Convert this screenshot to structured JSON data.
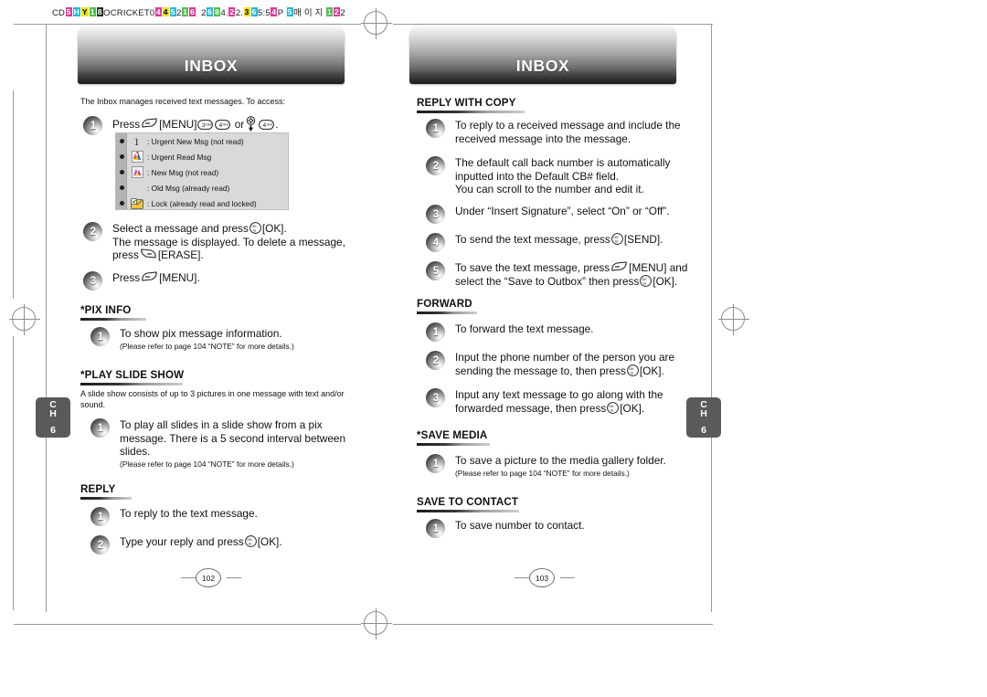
{
  "imprint": {
    "text": "CD  OCRICKET0  2  4.  2.  5:5  P  ",
    "tokens": [
      "CD",
      "OCRICKET0",
      "2",
      "4.",
      "2.",
      "5:5",
      "P",
      "매 이 지"
    ]
  },
  "chapter_tab": {
    "label_line1": "C",
    "label_line2": "H",
    "number": "6"
  },
  "left_page": {
    "title": "INBOX",
    "folio": "102",
    "intro": "The Inbox manages received text messages. To access:",
    "steps": [
      {
        "num": "1",
        "text": "Press",
        "text2": "[MENU]",
        "text3": "or",
        "text4": "."
      }
    ],
    "legend": {
      "items": [
        {
          "icon": "urgent-new-msg-icon",
          "label": ": Urgent New Msg (not read)"
        },
        {
          "icon": "urgent-read-msg-icon",
          "label": ": Urgent Read Msg"
        },
        {
          "icon": "new-msg-icon",
          "label": ": New Msg (not read)"
        },
        {
          "icon": "old-msg-icon",
          "label": ": Old Msg (already read)"
        },
        {
          "icon": "lock-msg-icon",
          "label": ": Lock (already read and locked)"
        }
      ]
    },
    "step2": {
      "num": "2",
      "line1a": "Select a message and press",
      "line1b": "[OK].",
      "line2": "The message is displayed. To delete a message,",
      "line3a": "press",
      "line3b": "[ERASE]."
    },
    "step3": {
      "num": "3",
      "line1a": "Press",
      "line1b": "[MENU]."
    },
    "sections": [
      {
        "id": "pix-info",
        "heading": "*PIX INFO",
        "steps": [
          {
            "num": "1",
            "text": "To show pix message information.",
            "note": "(Please refer to page 104 “NOTE” for more details.)"
          }
        ]
      },
      {
        "id": "play-slide-show",
        "heading": "*PLAY SLIDE SHOW",
        "intro": "A slide show consists of up to 3 pictures in one message with text and/or sound.",
        "steps": [
          {
            "num": "1",
            "text": "To play all slides in a slide show from a pix message. There is a 5 second interval between slides.",
            "note": "(Please refer to page 104 “NOTE” for more details.)"
          }
        ]
      },
      {
        "id": "reply",
        "heading": "REPLY",
        "steps": [
          {
            "num": "1",
            "text": "To reply to the text message."
          },
          {
            "num": "2",
            "text_a": "Type your reply and press",
            "text_b": "[OK]."
          }
        ]
      }
    ]
  },
  "right_page": {
    "title": "INBOX",
    "folio": "103",
    "sections": [
      {
        "id": "reply-with-copy",
        "heading": "REPLY WITH COPY",
        "steps": [
          {
            "num": "1",
            "text": "To reply to a received message and include the received message into the message."
          },
          {
            "num": "2",
            "text": "The default call back number is automatically inputted into the Default CB# field.",
            "text_line3": "You can scroll to the number and edit it."
          },
          {
            "num": "3",
            "text": "Under “Insert Signature”, select “On” or “Off”."
          },
          {
            "num": "4",
            "text_a": "To send the text message, press",
            "text_b": "[SEND]."
          },
          {
            "num": "5",
            "text_a": "To save the text message, press",
            "text_b": "[MENU] and",
            "text_c": "select the “Save to Outbox” then press",
            "text_d": "[OK]."
          }
        ]
      },
      {
        "id": "forward",
        "heading": "FORWARD",
        "steps": [
          {
            "num": "1",
            "text": "To forward the text message."
          },
          {
            "num": "2",
            "text_a": "Input the phone number of the person you are",
            "text_b": "sending the message to, then press",
            "text_c": "[OK]."
          },
          {
            "num": "3",
            "text_a": "Input any text message to go along with the",
            "text_b": "forwarded message, then press",
            "text_c": "[OK]."
          }
        ]
      },
      {
        "id": "save-media",
        "heading": "*SAVE MEDIA",
        "steps": [
          {
            "num": "1",
            "text": "To save a picture to the media gallery folder.",
            "note": "(Please refer to page 104 “NOTE” for more details.)"
          }
        ]
      },
      {
        "id": "save-to-contact",
        "heading": "SAVE TO CONTACT",
        "steps": [
          {
            "num": "1",
            "text": "To save number to contact."
          }
        ]
      }
    ]
  },
  "keys": {
    "menu": "soft-left-key",
    "ok": "ok-key",
    "erase": "soft-right-key",
    "num3": "3",
    "num4": "4",
    "nav": "navigation-key"
  },
  "colors": {
    "title_bar_dark": "#1c1c1c",
    "title_bar_light": "#fefefe",
    "chapter_tab": "#5a5a5a",
    "legend_bg": "#d9d9d9",
    "legend_strip": "#b4b4b4",
    "rule_dark": "#1d1d1d",
    "rule_light": "#cfcfcf"
  }
}
